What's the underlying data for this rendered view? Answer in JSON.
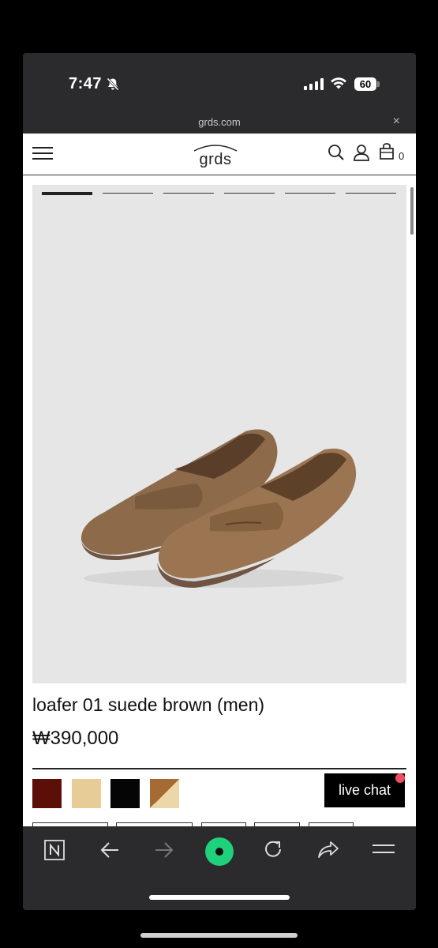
{
  "status": {
    "time": "7:47",
    "battery": "60"
  },
  "browser": {
    "url": "grds.com",
    "close_glyph": "×"
  },
  "site": {
    "logo": "grds",
    "cart_count": "0",
    "carousel": {
      "total": 6,
      "active": 1
    }
  },
  "product": {
    "title": "loafer 01 suede brown (men)",
    "price": "₩390,000",
    "swatches": [
      "#5c0f07",
      "#e8cc98",
      "#050505",
      "split-brown-cream"
    ],
    "live_chat": "live chat"
  },
  "icons": {
    "menu": "hamburger-icon",
    "search": "search-icon",
    "account": "user-icon",
    "cart": "shopping-bag-icon",
    "toolbar": [
      "naver-n-icon",
      "back-arrow-icon",
      "forward-arrow-icon",
      "green-home-icon",
      "reload-icon",
      "share-icon",
      "menu-icon"
    ]
  }
}
